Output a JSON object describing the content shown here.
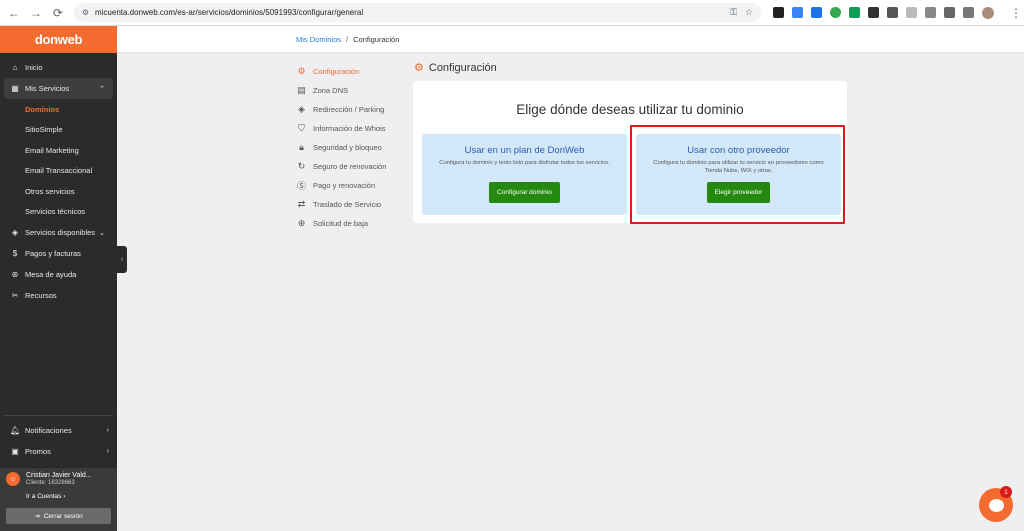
{
  "browser": {
    "url": "micuenta.donweb.com/es-ar/servicios/dominios/5091993/configurar/general"
  },
  "sidebar": {
    "brand": "donweb",
    "items": [
      {
        "label": "Inicio",
        "icon": "home-icon"
      },
      {
        "label": "Mis Servicios",
        "icon": "grid-icon"
      }
    ],
    "sub_items": [
      {
        "label": "Dominios"
      },
      {
        "label": "SitioSimple"
      },
      {
        "label": "Email Marketing"
      },
      {
        "label": "Email Transaccional"
      },
      {
        "label": "Otros servicios"
      },
      {
        "label": "Servicios técnicos"
      }
    ],
    "more_items": [
      {
        "label": "Servicios disponibles",
        "icon": "layers-icon"
      },
      {
        "label": "Pagos y facturas",
        "icon": "dollar-icon"
      },
      {
        "label": "Mesa de ayuda",
        "icon": "help-icon"
      },
      {
        "label": "Recursos",
        "icon": "tools-icon"
      }
    ],
    "bottom_items": [
      {
        "label": "Notificaciones",
        "icon": "bell-icon"
      },
      {
        "label": "Promos",
        "icon": "gift-icon"
      }
    ],
    "user": {
      "name": "Cristian Javier Vald...",
      "client": "Cliente: 16328663",
      "accounts_link": "Ir a Cuentas",
      "logout": "Cerrar sesión"
    }
  },
  "breadcrumb": {
    "parent": "Mis Dominios",
    "separator": "/",
    "current": "Configuración"
  },
  "settings_nav": [
    {
      "label": "Configuración",
      "icon": "gear-icon",
      "active": true
    },
    {
      "label": "Zona DNS",
      "icon": "document-icon"
    },
    {
      "label": "Redirección / Parking",
      "icon": "redirect-icon"
    },
    {
      "label": "Información de Whois",
      "icon": "shield-icon"
    },
    {
      "label": "Seguridad y bloqueo",
      "icon": "lock-icon"
    },
    {
      "label": "Seguro de renovación",
      "icon": "renew-icon"
    },
    {
      "label": "Pago y renovación",
      "icon": "dollar-icon"
    },
    {
      "label": "Traslado de Servicio",
      "icon": "transfer-icon"
    },
    {
      "label": "Solicitud de baja",
      "icon": "download-icon"
    }
  ],
  "main": {
    "section_title": "Configuración",
    "card_title": "Elige dónde deseas utilizar tu dominio",
    "options": [
      {
        "title": "Usar en un plan de DonWeb",
        "description": "Configura tu dominio y tenlo listo para disfrutar todos los servicios.",
        "button": "Configurar dominio"
      },
      {
        "title": "Usar con otro proveedor",
        "description": "Configura tu dominio para utilizar tu servicio en proveedores como Tienda Nube, WIX y otras.",
        "button": "Elegir proveedor"
      }
    ]
  },
  "chat": {
    "badge": "1"
  },
  "colors": {
    "brand": "#f46b2f",
    "sidebar_bg": "#2b2b2b",
    "option_bg": "#d2e8f9",
    "button_green": "#248a0f",
    "highlight_red": "#e0191b"
  }
}
